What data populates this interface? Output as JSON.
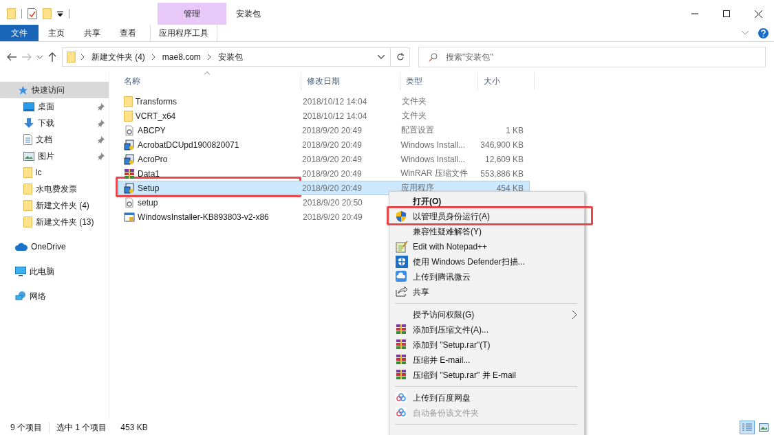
{
  "window": {
    "title": "安装包",
    "context_group": "管理"
  },
  "ribbon_tabs": [
    {
      "label": "文件",
      "kind": "file"
    },
    {
      "label": "主页",
      "kind": "tab"
    },
    {
      "label": "共享",
      "kind": "tab"
    },
    {
      "label": "查看",
      "kind": "tab"
    },
    {
      "label": "应用程序工具",
      "kind": "context"
    }
  ],
  "address": {
    "segments": [
      "新建文件夹 (4)",
      "mae8.com",
      "安装包"
    ]
  },
  "search": {
    "placeholder": "搜索\"安装包\""
  },
  "sidebar": {
    "items": [
      {
        "label": "快速访问",
        "kind": "star",
        "selected": true,
        "children": [
          {
            "label": "桌面",
            "kind": "desktop",
            "pinned": true,
            "selected": false
          },
          {
            "label": "下载",
            "kind": "download",
            "pinned": true,
            "selected": false
          },
          {
            "label": "文档",
            "kind": "document",
            "pinned": true,
            "selected": false
          },
          {
            "label": "图片",
            "kind": "pictures",
            "pinned": true,
            "selected": false
          },
          {
            "label": "lc",
            "kind": "folder",
            "pinned": false,
            "selected": false
          },
          {
            "label": "水电费发票",
            "kind": "folder",
            "pinned": false,
            "selected": false
          },
          {
            "label": "新建文件夹 (4)",
            "kind": "folder",
            "pinned": false,
            "selected": false
          },
          {
            "label": "新建文件夹 (13)",
            "kind": "folder",
            "pinned": false,
            "selected": false
          }
        ]
      },
      {
        "label": "OneDrive",
        "kind": "cloud",
        "selected": false
      },
      {
        "label": "此电脑",
        "kind": "computer",
        "selected": false
      },
      {
        "label": "网络",
        "kind": "network",
        "selected": false
      }
    ]
  },
  "table": {
    "columns": [
      "名称",
      "修改日期",
      "类型",
      "大小"
    ],
    "rows": [
      {
        "name": "Transforms",
        "date": "2018/10/12 14:04",
        "type": "文件夹",
        "size": "",
        "kind": "folder",
        "selected": false,
        "highlighted": false
      },
      {
        "name": "VCRT_x64",
        "date": "2018/10/12 14:04",
        "type": "文件夹",
        "size": "",
        "kind": "folder",
        "selected": false,
        "highlighted": false
      },
      {
        "name": "ABCPY",
        "date": "2018/9/20 20:49",
        "type": "配置设置",
        "size": "1 KB",
        "kind": "config",
        "selected": false,
        "highlighted": false
      },
      {
        "name": "AcrobatDCUpd1900820071",
        "date": "2018/9/20 20:49",
        "type": "Windows Install...",
        "size": "346,900 KB",
        "kind": "installer",
        "selected": false,
        "highlighted": false
      },
      {
        "name": "AcroPro",
        "date": "2018/9/20 20:49",
        "type": "Windows Install...",
        "size": "12,609 KB",
        "kind": "installer",
        "selected": false,
        "highlighted": false
      },
      {
        "name": "Data1",
        "date": "2018/9/20 20:49",
        "type": "WinRAR 压缩文件",
        "size": "553,886 KB",
        "kind": "archive",
        "selected": false,
        "highlighted": false
      },
      {
        "name": "Setup",
        "date": "2018/9/20 20:49",
        "type": "应用程序",
        "size": "454 KB",
        "kind": "installer",
        "selected": true,
        "highlighted": true
      },
      {
        "name": "setup",
        "date": "2018/9/20 20:50",
        "type": "",
        "size": "",
        "kind": "config",
        "selected": false,
        "highlighted": false
      },
      {
        "name": "WindowsInstaller-KB893803-v2-x86",
        "date": "2018/9/20 20:49",
        "type": "",
        "size": "",
        "kind": "program",
        "selected": false,
        "highlighted": false
      }
    ]
  },
  "context_menu": {
    "items": [
      {
        "kind": "default",
        "label": "打开(O)",
        "highlighted": false,
        "disabled": false
      },
      {
        "kind": "admin",
        "label": "以管理员身份运行(A)",
        "highlighted": true,
        "disabled": false
      },
      {
        "kind": "plain",
        "label": "兼容性疑难解答(Y)",
        "highlighted": false,
        "disabled": false
      },
      {
        "kind": "editor",
        "label": "Edit with Notepad++",
        "highlighted": false,
        "disabled": false
      },
      {
        "kind": "scanner",
        "label": "使用 Windows Defender扫描...",
        "highlighted": false,
        "disabled": false
      },
      {
        "kind": "upload",
        "label": "上传到腾讯微云",
        "highlighted": false,
        "disabled": false
      },
      {
        "kind": "share",
        "label": "共享",
        "highlighted": false,
        "disabled": false
      },
      {
        "kind": "separator"
      },
      {
        "kind": "submenu",
        "label": "授予访问权限(G)",
        "highlighted": false,
        "disabled": false
      },
      {
        "kind": "archive",
        "label": "添加到压缩文件(A)...",
        "highlighted": false,
        "disabled": false
      },
      {
        "kind": "archive",
        "label": "添加到 \"Setup.rar\"(T)",
        "highlighted": false,
        "disabled": false
      },
      {
        "kind": "archive",
        "label": "压缩并 E-mail...",
        "highlighted": false,
        "disabled": false
      },
      {
        "kind": "archive",
        "label": "压缩到 \"Setup.rar\" 并 E-mail",
        "highlighted": false,
        "disabled": false
      },
      {
        "kind": "separator"
      },
      {
        "kind": "baidu",
        "label": "上传到百度网盘",
        "highlighted": false,
        "disabled": false
      },
      {
        "kind": "baidu",
        "label": "自动备份该文件夹",
        "highlighted": false,
        "disabled": true
      },
      {
        "kind": "separator"
      }
    ]
  },
  "status_bar": {
    "count": "9 个项目",
    "selection": "选中 1 个项目",
    "size": "453 KB",
    "views": [
      {
        "kind": "details",
        "selected": true
      },
      {
        "kind": "thumbnails",
        "selected": false
      }
    ]
  }
}
